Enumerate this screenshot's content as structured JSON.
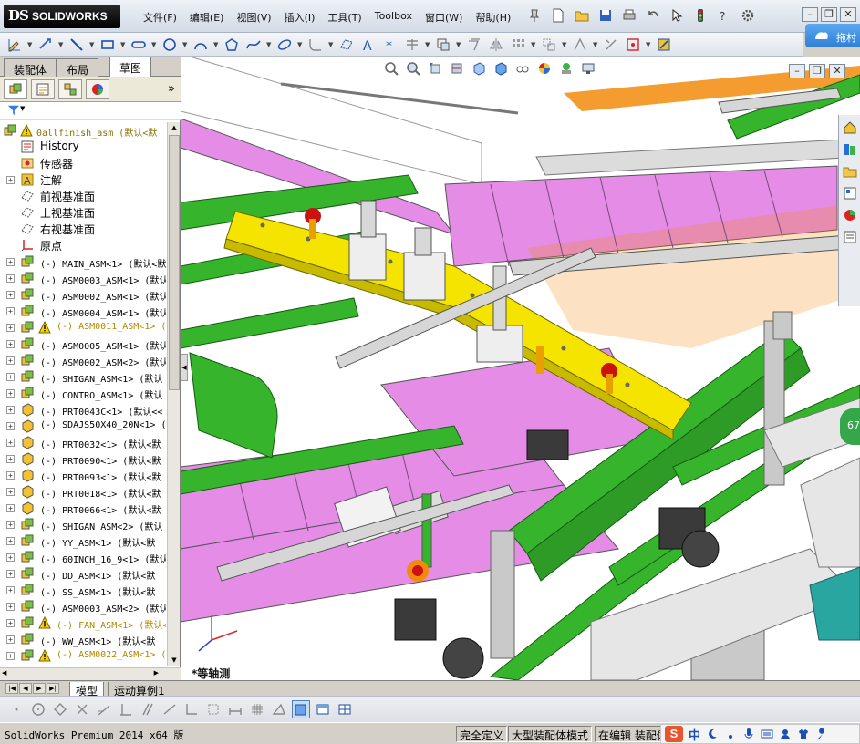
{
  "app": {
    "logo_ds": "DS",
    "logo_text": "SOLIDWORKS",
    "menu": [
      "文件(F)",
      "编辑(E)",
      "视图(V)",
      "插入(I)",
      "工具(T)",
      "Toolbox",
      "窗口(W)",
      "帮助(H)"
    ],
    "task_pane_label": "拖村"
  },
  "command_manager": {
    "tabs": [
      "装配体",
      "布局",
      "草图"
    ],
    "active_tab": "草图"
  },
  "feature_manager": {
    "filter_icon": "filter-icon",
    "root": "0allfinish_asm  (默认<默",
    "items": [
      {
        "label": "History",
        "kind": "history",
        "expand": false
      },
      {
        "label": "传感器",
        "kind": "sensor",
        "expand": false
      },
      {
        "label": "注解",
        "kind": "annotation",
        "expand": true
      },
      {
        "label": "前视基准面",
        "kind": "plane",
        "expand": false
      },
      {
        "label": "上视基准面",
        "kind": "plane",
        "expand": false
      },
      {
        "label": "右视基准面",
        "kind": "plane",
        "expand": false
      },
      {
        "label": "原点",
        "kind": "origin",
        "expand": false
      },
      {
        "label": "(-) MAIN_ASM<1> (默认<默",
        "kind": "asm",
        "expand": true
      },
      {
        "label": "(-) ASM0003_ASM<1> (默认",
        "kind": "asm",
        "expand": true
      },
      {
        "label": "(-) ASM0002_ASM<1> (默认",
        "kind": "asm",
        "expand": true
      },
      {
        "label": "(-) ASM0004_ASM<1> (默认",
        "kind": "asm",
        "expand": true
      },
      {
        "label": "(-) ASM0011_ASM<1> (",
        "kind": "asm",
        "expand": true,
        "warning": true
      },
      {
        "label": "(-) ASM0005_ASM<1> (默认",
        "kind": "asm",
        "expand": true
      },
      {
        "label": "(-) ASM0002_ASM<2> (默认",
        "kind": "asm",
        "expand": true
      },
      {
        "label": "(-) SHIGAN_ASM<1> (默认",
        "kind": "asm",
        "expand": true
      },
      {
        "label": "(-) CONTRO_ASM<1> (默认",
        "kind": "asm",
        "expand": true
      },
      {
        "label": "(-) PRT0043C<1> (默认<<",
        "kind": "part",
        "expand": true
      },
      {
        "label": "(-) SDAJS50X40_20N<1> (",
        "kind": "part",
        "expand": true
      },
      {
        "label": "(-) PRT0032<1> (默认<默",
        "kind": "part",
        "expand": true
      },
      {
        "label": "(-) PRT0090<1> (默认<默",
        "kind": "part",
        "expand": true
      },
      {
        "label": "(-) PRT0093<1> (默认<默",
        "kind": "part",
        "expand": true
      },
      {
        "label": "(-) PRT0018<1> (默认<默",
        "kind": "part",
        "expand": true
      },
      {
        "label": "(-) PRT0066<1> (默认<默",
        "kind": "part",
        "expand": true
      },
      {
        "label": "(-) SHIGAN_ASM<2> (默认",
        "kind": "asm",
        "expand": true
      },
      {
        "label": "(-) YY_ASM<1> (默认<默",
        "kind": "asm",
        "expand": true
      },
      {
        "label": "(-) 60INCH_16_9<1> (默认",
        "kind": "asm",
        "expand": true
      },
      {
        "label": "(-) DD_ASM<1> (默认<默",
        "kind": "asm",
        "expand": true
      },
      {
        "label": "(-) SS_ASM<1> (默认<默",
        "kind": "asm",
        "expand": true
      },
      {
        "label": "(-) ASM0003_ASM<2> (默认",
        "kind": "asm",
        "expand": true
      },
      {
        "label": "(-) FAN_ASM<1> (默认<",
        "kind": "asm",
        "expand": true,
        "warning": true
      },
      {
        "label": "(-) WW_ASM<1> (默认<默",
        "kind": "asm",
        "expand": true
      },
      {
        "label": "(-) ASM0022_ASM<1> (",
        "kind": "asm",
        "expand": true,
        "warning": true
      }
    ]
  },
  "viewport": {
    "view_label": "*等轴测",
    "badge": "67"
  },
  "bottom_tabs": [
    "模型",
    "运动算例1"
  ],
  "active_bottom_tab": "模型",
  "status": {
    "app_version": "SolidWorks Premium 2014 x64 版",
    "fields": [
      "完全定义",
      "大型装配体模式",
      "在编辑 装配体"
    ],
    "ime_label": "中"
  },
  "colors": {
    "frame_green": "#35b42c",
    "plate_yellow": "#f4e400",
    "conveyor_pink": "#e48ce6",
    "accent_orange": "#f28b0c",
    "status_badge_green": "#35a64a"
  }
}
